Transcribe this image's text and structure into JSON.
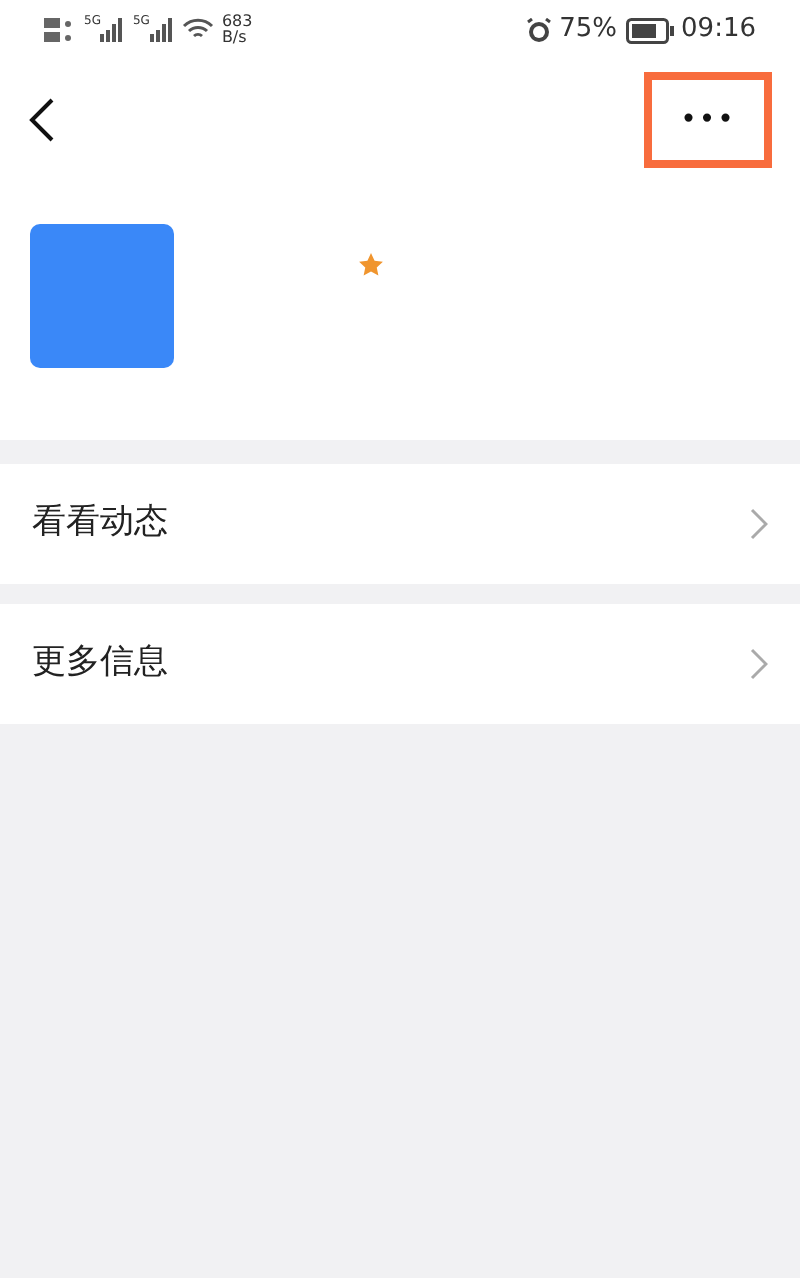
{
  "status_bar": {
    "network_1": "5G",
    "network_2": "5G",
    "speed": "683",
    "speed_unit": "B/s",
    "battery": "75%",
    "time": "09:16"
  },
  "header": {
    "more_button": {
      "label": "•••",
      "highlighted": true
    }
  },
  "profile": {
    "starred": true
  },
  "menu_items": [
    {
      "label": "看看动态"
    },
    {
      "label": "更多信息"
    }
  ]
}
